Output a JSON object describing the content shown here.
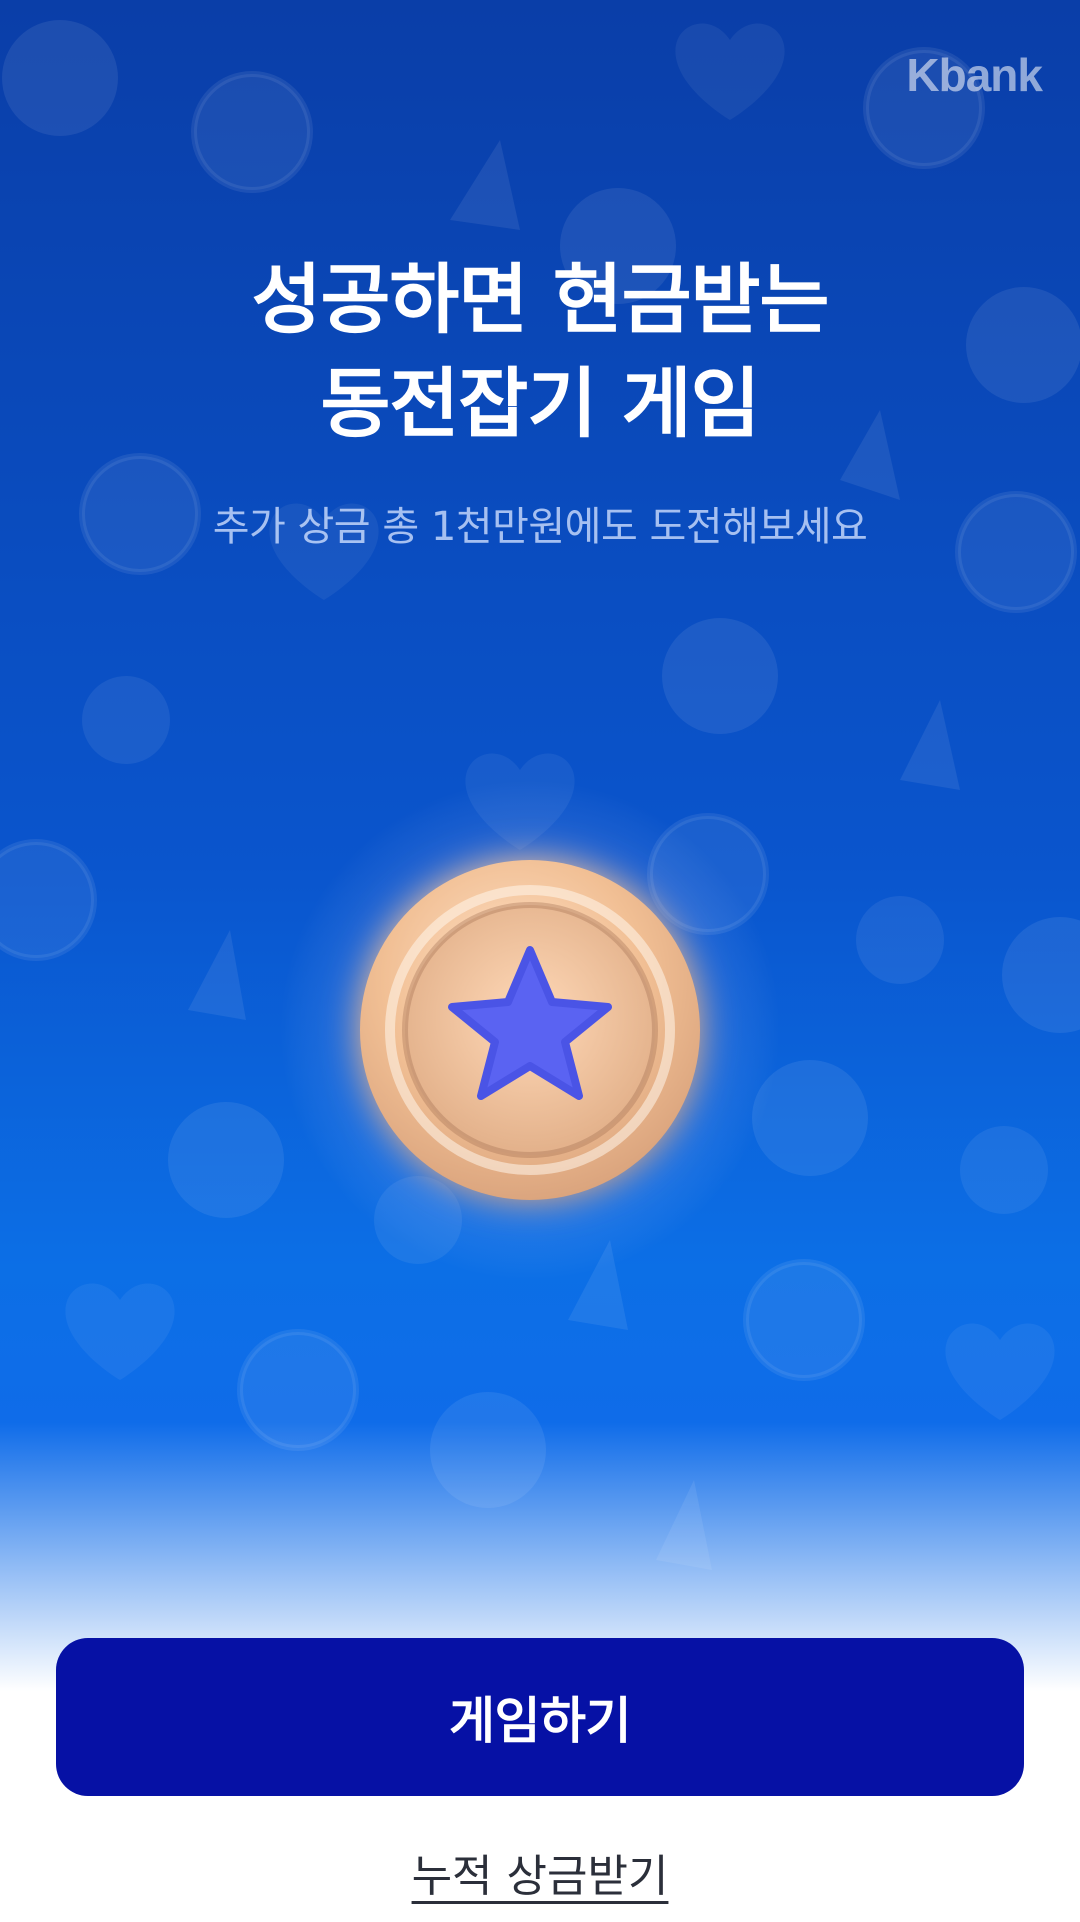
{
  "brand": {
    "logo_text": "Kbank"
  },
  "hero": {
    "title_line1": "성공하면 현금받는",
    "title_line2": "동전잡기 게임",
    "subtitle": "추가 상금 총 1천만원에도 도전해보세요"
  },
  "coin": {
    "icon": "star-coin-icon",
    "colors": {
      "rim": "#f2c6a0",
      "face": "#f5c79f",
      "star": "#5a63f2"
    }
  },
  "actions": {
    "play_label": "게임하기",
    "rewards_link": "누적 상금받기"
  },
  "colors": {
    "accent": "#0611a5",
    "background_top": "#0a3ea8",
    "background_mid": "#0c6fe6"
  }
}
